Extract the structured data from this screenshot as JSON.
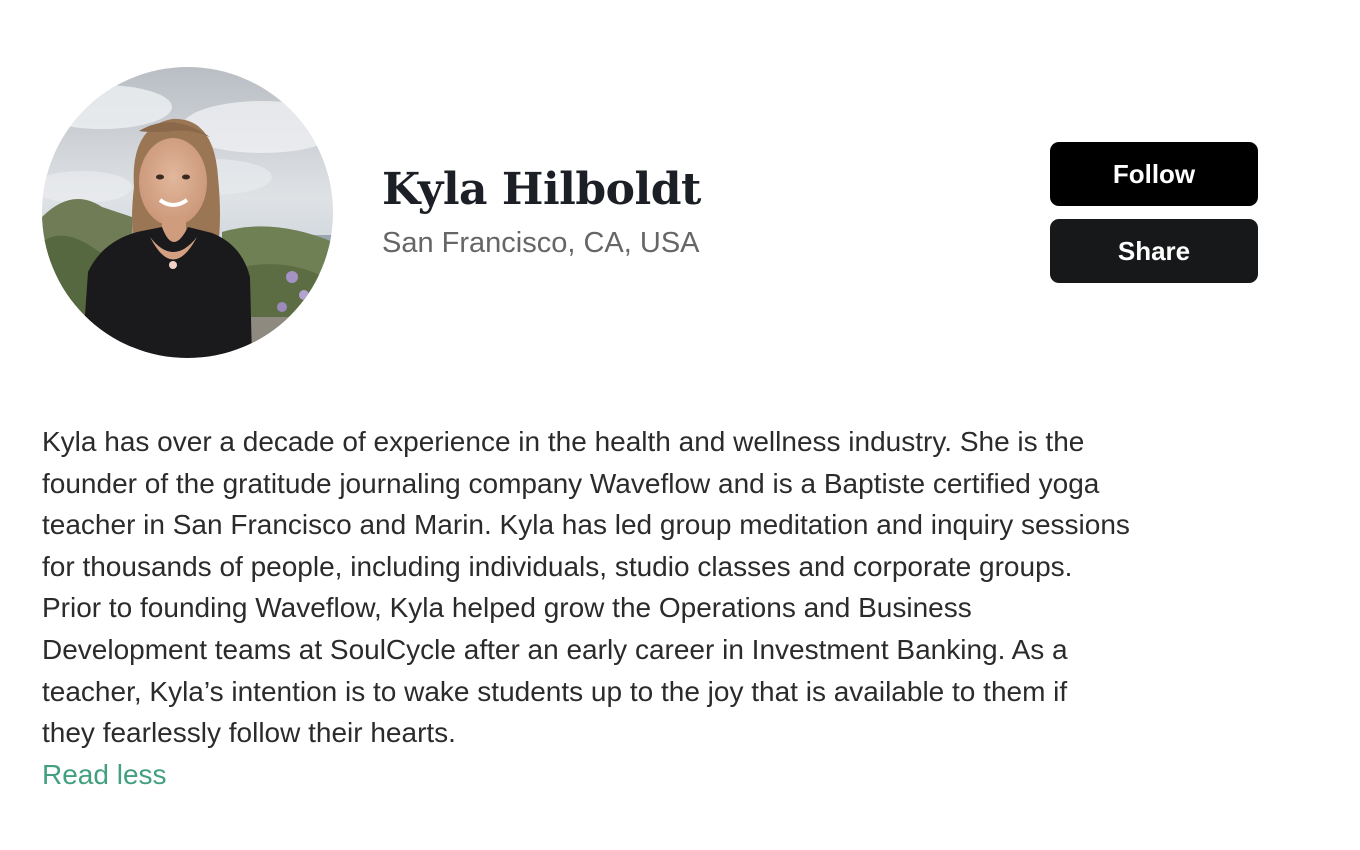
{
  "profile": {
    "name": "Kyla Hilboldt",
    "location": "San Francisco, CA, USA"
  },
  "actions": {
    "follow_label": "Follow",
    "share_label": "Share"
  },
  "bio": {
    "lines": [
      "Kyla has over a decade of experience in the health and wellness industry. She is the",
      "founder of the gratitude journaling company Waveflow and is a Baptiste certified yoga",
      "teacher in San Francisco and Marin. Kyla has led group meditation and inquiry sessions",
      "for thousands of people, including individuals, studio classes and corporate groups.",
      "Prior to founding Waveflow, Kyla helped grow the Operations and Business",
      "Development teams at SoulCycle after an early career in Investment Banking. As a",
      "teacher, Kyla’s intention is to wake students up to the joy that is available to them if",
      "they fearlessly follow their hearts."
    ],
    "toggle_label": "Read less"
  },
  "colors": {
    "follow_bg": "#000000",
    "share_bg": "#161819",
    "link": "#43a07f",
    "location_text": "#666666"
  }
}
